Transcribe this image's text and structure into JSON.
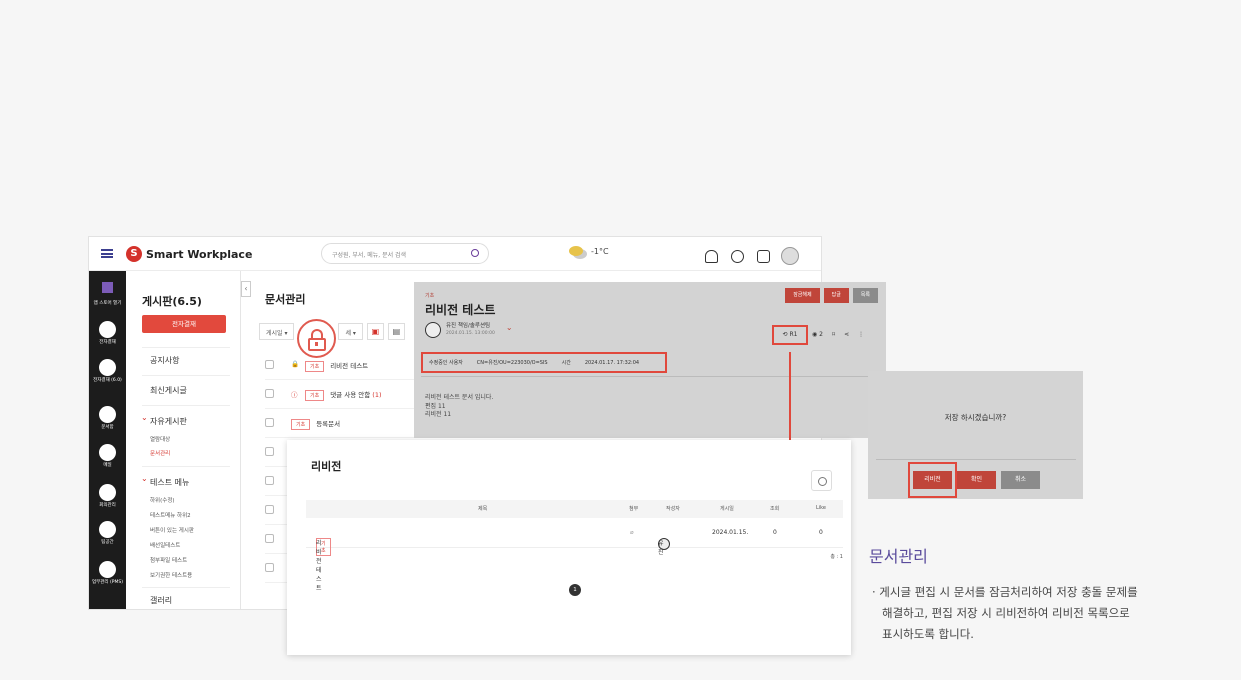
{
  "app": {
    "logo_letter": "S",
    "logo_text": "Smart Workplace",
    "search_placeholder": "구성원, 부서, 메뉴, 문서 검색",
    "weather": "-1°C"
  },
  "rail": [
    "앱 스토어 열기",
    "전자결재",
    "전자결재 (6.0)",
    "문서함",
    "메일",
    "회의관리",
    "팀공간",
    "업무관리 (PMS)"
  ],
  "sidebar": {
    "title": "게시판(6.5)",
    "approval_button": "전자결재",
    "notice": "공지사항",
    "latest": "최신게시글",
    "free_board": "자유게시판",
    "free_sub": [
      "열람대상",
      "문서관리"
    ],
    "test_menu": "테스트 메뉴",
    "test_sub": [
      "하위(수정)",
      "테스트메뉴 하위2",
      "버튼이 있는 게시판",
      "배선일테스트",
      "첨부파일 테스트",
      "보기권한 테스트용"
    ],
    "gallery": "갤러리"
  },
  "main": {
    "title": "문서관리",
    "filter_select": "게시일",
    "filter_select2": "세",
    "rows": [
      {
        "tag": "기초",
        "title": "리비전 테스트"
      },
      {
        "tag": "기초",
        "title": "댓글 사용 안함",
        "count": "(1)"
      },
      {
        "tag": "기초",
        "title": "등록문서"
      }
    ]
  },
  "doc": {
    "category": "기초",
    "title": "리비전 테스트",
    "buttons": {
      "unlock": "잠금해제",
      "reply": "답글",
      "list": "목록"
    },
    "author": "유진 책임/솔루션팀",
    "date": "2024.01.15. 13:00:00",
    "revision": "R1",
    "views": "2",
    "rev_label_user": "수정중인 사용자",
    "rev_user": "CN=유진/OU=223030/O=SIS",
    "rev_label_time": "시간",
    "rev_time": "2024.01.17. 17:32:04",
    "body": [
      "리비전 테스트 문서 입니다.",
      "편집 11",
      "리비전 11"
    ]
  },
  "revision_panel": {
    "title": "리비전",
    "headers": {
      "title": "제목",
      "attach": "첨부",
      "author": "작성자",
      "date": "게시일",
      "views": "조회",
      "like": "Like"
    },
    "row": {
      "tag": "기초",
      "title": "리비전 테스트",
      "author": "유진",
      "date": "2024.01.15.",
      "views": "0",
      "like": "0"
    },
    "total": "총 : 1",
    "page": "1"
  },
  "confirm": {
    "message": "저장 하시겠습니까?",
    "revision_btn": "리비전",
    "ok_btn": "확인",
    "cancel_btn": "취소"
  },
  "caption": {
    "title": "문서관리",
    "lines": [
      "· 게시글 편집 시 문서를 잠금처리하여 저장 충돌 문제를",
      "해결하고, 편집 저장 시 리비전하여 리비전 목록으로",
      "표시하도록 합니다."
    ]
  },
  "colors": {
    "accent": "#e0483c",
    "brand": "#d4322b",
    "caption": "#5a4b9c"
  }
}
